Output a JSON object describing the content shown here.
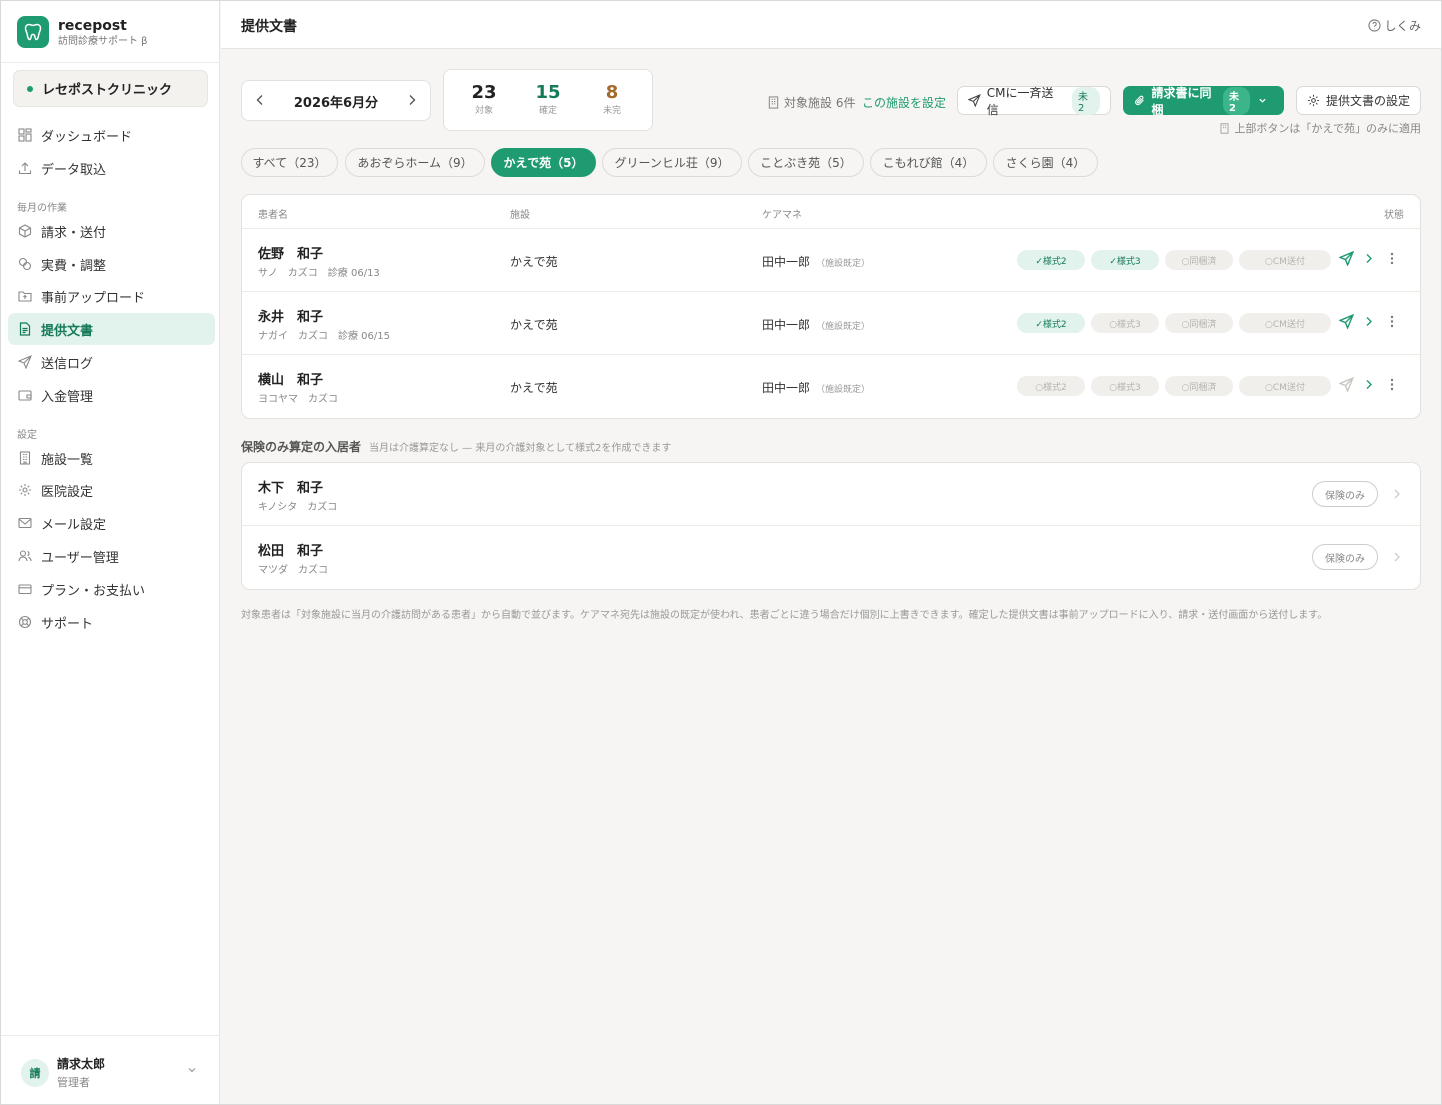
{
  "app": {
    "name": "recepost",
    "subtitle": "訪問診療サポート β",
    "clinic": "レセポストクリニック"
  },
  "sidebar": {
    "items": [
      {
        "label": "ダッシュボード",
        "icon": "grid-icon"
      },
      {
        "label": "データ取込",
        "icon": "upload-icon"
      }
    ],
    "section_monthly": "毎月の作業",
    "monthly_items": [
      {
        "label": "請求・送付",
        "icon": "box-icon"
      },
      {
        "label": "実費・調整",
        "icon": "coins-icon"
      },
      {
        "label": "事前アップロード",
        "icon": "folder-upload-icon"
      },
      {
        "label": "提供文書",
        "icon": "document-icon",
        "active": true
      },
      {
        "label": "送信ログ",
        "icon": "send-icon"
      },
      {
        "label": "入金管理",
        "icon": "wallet-icon"
      }
    ],
    "section_settings": "設定",
    "settings_items": [
      {
        "label": "施設一覧",
        "icon": "building-icon"
      },
      {
        "label": "医院設定",
        "icon": "gear-icon"
      },
      {
        "label": "メール設定",
        "icon": "mail-icon"
      },
      {
        "label": "ユーザー管理",
        "icon": "users-icon"
      },
      {
        "label": "プラン・お支払い",
        "icon": "card-icon"
      },
      {
        "label": "サポート",
        "icon": "lifebuoy-icon"
      }
    ],
    "user": {
      "avatar": "請",
      "name": "請求太郎",
      "role": "管理者"
    }
  },
  "header": {
    "title": "提供文書",
    "help": "しくみ"
  },
  "month": {
    "label": "2026年6月分"
  },
  "stats": [
    {
      "value": "23",
      "label": "対象",
      "color": "#222222"
    },
    {
      "value": "15",
      "label": "確定",
      "color": "#157a58"
    },
    {
      "value": "8",
      "label": "未完",
      "color": "#a26a2e"
    }
  ],
  "toolbar": {
    "facility_count": "対象施設 6件",
    "facility_set": "この施設を設定",
    "cm_send": "CMに一斉送信",
    "cm_send_badge": "未2",
    "attach": "請求書に同梱",
    "attach_badge": "未2",
    "settings": "提供文書の設定",
    "hint": "上部ボタンは「かえで苑」のみに適用"
  },
  "filters": [
    {
      "label": "すべて（23）"
    },
    {
      "label": "あおぞらホーム（9）"
    },
    {
      "label": "かえで苑（5）",
      "active": true
    },
    {
      "label": "グリーンヒル荘（9）"
    },
    {
      "label": "ことぶき苑（5）"
    },
    {
      "label": "こもれび館（4）"
    },
    {
      "label": "さくら園（4）"
    }
  ],
  "table": {
    "headers": {
      "name": "患者名",
      "facility": "施設",
      "caremanager": "ケアマネ",
      "status": "状態"
    },
    "rows": [
      {
        "name": "佐野　和子",
        "kana": "サノ　カズコ　診療 06/13",
        "facility": "かえで苑",
        "cm": "田中一郎",
        "cm_note": "（施設既定）",
        "chips": [
          "✓様式2",
          "✓様式3",
          "○同梱済",
          "○CM送付"
        ],
        "chip_on": [
          true,
          true,
          false,
          false
        ],
        "send_active": true
      },
      {
        "name": "永井　和子",
        "kana": "ナガイ　カズコ　診療 06/15",
        "facility": "かえで苑",
        "cm": "田中一郎",
        "cm_note": "（施設既定）",
        "chips": [
          "✓様式2",
          "○様式3",
          "○同梱済",
          "○CM送付"
        ],
        "chip_on": [
          true,
          false,
          false,
          false
        ],
        "send_active": true
      },
      {
        "name": "横山　和子",
        "kana": "ヨコヤマ　カズコ",
        "facility": "かえで苑",
        "cm": "田中一郎",
        "cm_note": "（施設既定）",
        "chips": [
          "○様式2",
          "○様式3",
          "○同梱済",
          "○CM送付"
        ],
        "chip_on": [
          false,
          false,
          false,
          false
        ],
        "send_active": false
      }
    ]
  },
  "insurance": {
    "title": "保険のみ算定の入居者",
    "note": "当月は介護算定なし — 来月の介護対象として様式2を作成できます",
    "badge": "保険のみ",
    "rows": [
      {
        "name": "木下　和子",
        "kana": "キノシタ　カズコ"
      },
      {
        "name": "松田　和子",
        "kana": "マツダ　カズコ"
      }
    ]
  },
  "footnote": "対象患者は「対象施設に当月の介護訪問がある患者」から自動で並びます。ケアマネ宛先は施設の既定が使われ、患者ごとに違う場合だけ個別に上書きできます。確定した提供文書は事前アップロードに入り、請求・送付画面から送付します。",
  "colors": {
    "accent": "#1f9b72",
    "accent_light": "#e2f2ec",
    "pending": "#a26a2e"
  }
}
